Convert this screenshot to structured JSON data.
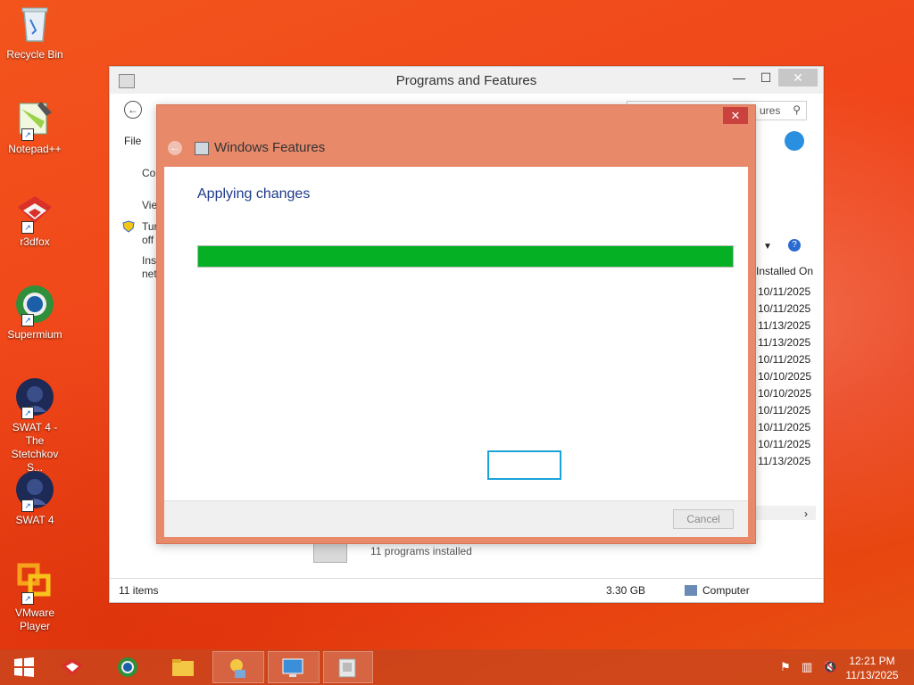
{
  "desktop": {
    "icons": [
      {
        "label": "Recycle Bin"
      },
      {
        "label": "Notepad++"
      },
      {
        "label": "r3dfox"
      },
      {
        "label": "Supermium"
      },
      {
        "label": "SWAT 4 - The Stetchkov S..."
      },
      {
        "label": "SWAT 4"
      },
      {
        "label": "VMware Player"
      }
    ]
  },
  "window": {
    "title": "Programs and Features",
    "min_glyph": "—",
    "max_glyph": "☐",
    "close_glyph": "✕",
    "search_placeholder": "ures",
    "menu_file": "File",
    "left_pane": [
      "Co",
      "Vie",
      "Tur",
      "off",
      "Inst",
      "net"
    ],
    "column_header": "Installed On",
    "dates": [
      "10/11/2025",
      "10/11/2025",
      "11/13/2025",
      "11/13/2025",
      "10/11/2025",
      "10/10/2025",
      "10/10/2025",
      "10/11/2025",
      "10/11/2025",
      "10/11/2025",
      "11/13/2025"
    ],
    "programs_installed": "11 programs installed",
    "status_items": "11 items",
    "status_size": "3.30 GB",
    "status_computer": "Computer"
  },
  "dialog": {
    "title": "Windows Features",
    "close_glyph": "✕",
    "heading": "Applying changes",
    "progress_percent": 100,
    "progress_color": "#06b025",
    "cancel_label": "Cancel"
  },
  "taskbar": {
    "start_icon": "windows-logo-icon",
    "apps": [
      "r3dfox",
      "Supermium",
      "File Explorer",
      "Windows Features",
      "Control Panel",
      "Programs and Features"
    ],
    "time": "12:21 PM",
    "date": "11/13/2025"
  },
  "colors": {
    "desktop_accent": "#f0461a",
    "dialog_frame": "#e8896a",
    "close_red": "#c9423e",
    "focus_blue": "#1aa3d8"
  }
}
